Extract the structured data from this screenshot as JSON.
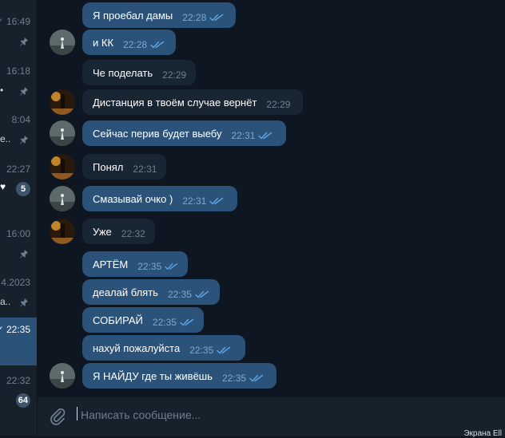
{
  "sidebar": {
    "items": [
      {
        "time": "✓ 16:49",
        "preview": "",
        "pinned": true,
        "badge": "",
        "check": false
      },
      {
        "time": "16:18",
        "preview": "•",
        "pinned": true,
        "badge": "",
        "check": false
      },
      {
        "time": "8:04",
        "preview": "e..",
        "pinned": true,
        "badge": "",
        "check": false
      },
      {
        "time": "22:27",
        "preview": "",
        "pinned": false,
        "badge": "5",
        "check": false
      },
      {
        "time": "16:00",
        "preview": "",
        "pinned": true,
        "badge": "",
        "check": false
      },
      {
        "time": "4.2023",
        "preview": "а..",
        "pinned": true,
        "badge": "",
        "check": false
      },
      {
        "time": "✓ 22:35",
        "preview": "",
        "pinned": false,
        "badge": "",
        "check": false
      },
      {
        "time": "22:32",
        "preview": "",
        "pinned": false,
        "badge": "64",
        "check": false
      }
    ]
  },
  "messages": [
    {
      "text": "Я проебал дамы",
      "time": "22:28",
      "direction": "out",
      "read": true,
      "avatar": false
    },
    {
      "text": "и КК",
      "time": "22:28",
      "direction": "out",
      "read": true,
      "avatar": "grey"
    },
    {
      "text": "Че поделать",
      "time": "22:29",
      "direction": "in",
      "read": false,
      "avatar": false
    },
    {
      "text": "Дистанция в твоём случае вернёт",
      "time": "22:29",
      "direction": "in",
      "read": false,
      "avatar": "gold"
    },
    {
      "text": "Сейчас перив будет выебу",
      "time": "22:31",
      "direction": "out",
      "read": true,
      "avatar": "grey"
    },
    {
      "text": "Понял",
      "time": "22:31",
      "direction": "in",
      "read": false,
      "avatar": "gold"
    },
    {
      "text": "Смазывай очко )",
      "time": "22:31",
      "direction": "out",
      "read": true,
      "avatar": "grey"
    },
    {
      "text": "Уже",
      "time": "22:32",
      "direction": "in",
      "read": false,
      "avatar": "gold"
    },
    {
      "text": "АРТЁМ",
      "time": "22:35",
      "direction": "out",
      "read": true,
      "avatar": false
    },
    {
      "text": "деалай блять",
      "time": "22:35",
      "direction": "out",
      "read": true,
      "avatar": false
    },
    {
      "text": "СОБИРАЙ",
      "time": "22:35",
      "direction": "out",
      "read": true,
      "avatar": false
    },
    {
      "text": "нахуй пожалуйста",
      "time": "22:35",
      "direction": "out",
      "read": true,
      "avatar": false
    },
    {
      "text": "Я НАЙДУ где ты живёшь",
      "time": "22:35",
      "direction": "out",
      "read": true,
      "avatar": "grey"
    }
  ],
  "composer": {
    "placeholder": "Написать сообщение...",
    "value": ""
  },
  "corner_text": "Экрана Ell",
  "colors": {
    "background": "#0e1621",
    "panel": "#17212b",
    "outgoing_bubble": "#2b5278",
    "incoming_bubble": "#182533",
    "read_check": "#5fa6e6"
  }
}
